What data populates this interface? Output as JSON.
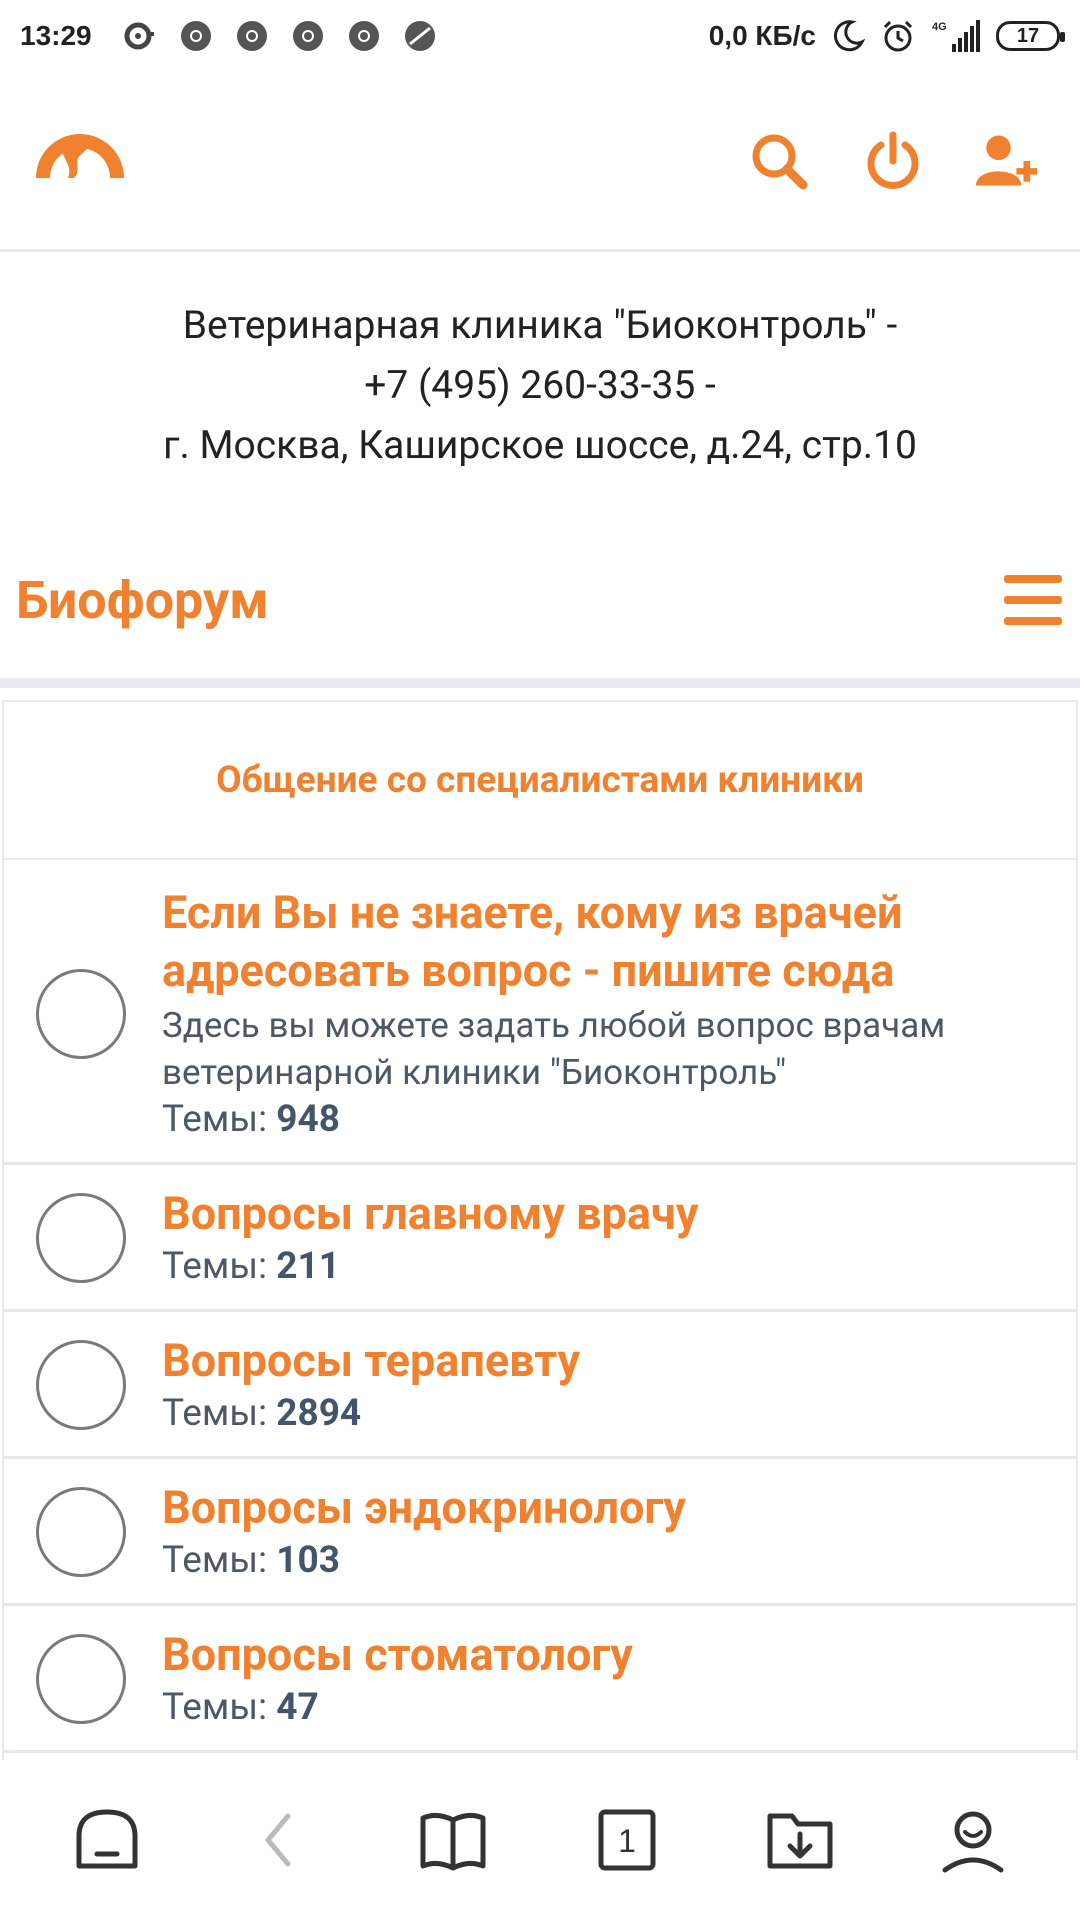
{
  "status_bar": {
    "time": "13:29",
    "net_speed": "0,0 КБ/с",
    "network_type": "4G",
    "battery": "17"
  },
  "header": {
    "logo_icon": "logo-icon",
    "actions": [
      "search-icon",
      "power-icon",
      "add-user-icon"
    ]
  },
  "clinic": {
    "line1": "Ветеринарная клиника \"Биоконтроль\" -",
    "line2": "+7 (495) 260-33-35 -",
    "line3": "г. Москва, Каширское шоссе, д.24, стр.10"
  },
  "forum": {
    "title": "Биофорум",
    "category_title": "Общение со специалистами клиники",
    "stats_label": "Темы:",
    "items": [
      {
        "title_line1": "Если Вы не знаете, кому из врачей",
        "title_line2": "адресовать вопрос - пишите сюда",
        "desc_line1": "Здесь вы можете задать любой вопрос врачам",
        "desc_line2": "ветеринарной клиники \"Биоконтроль\"",
        "count": "948"
      },
      {
        "title": "Вопросы главному врачу",
        "count": "211"
      },
      {
        "title": "Вопросы терапевту",
        "count": "2894"
      },
      {
        "title": "Вопросы эндокринологу",
        "count": "103"
      },
      {
        "title": "Вопросы стоматологу",
        "count": "47"
      }
    ]
  },
  "bottom_nav": [
    "home-icon",
    "back-icon",
    "bookmarks-icon",
    "tabs-icon",
    "downloads-icon",
    "profile-icon"
  ],
  "tabs_count": "1",
  "colors": {
    "accent": "#f0812f",
    "text_muted": "#4d5866",
    "border": "#e6e8ec"
  }
}
